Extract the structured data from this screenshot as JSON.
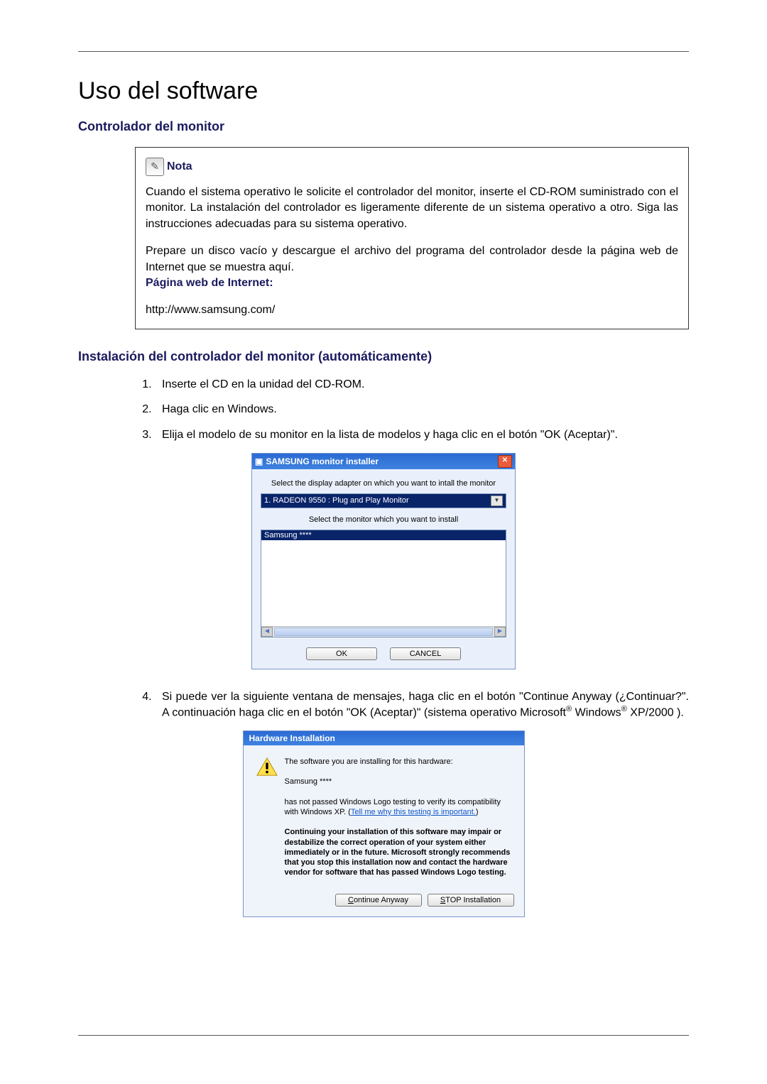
{
  "title": "Uso del software",
  "section_a": "Controlador del monitor",
  "note": {
    "label": "Nota",
    "p1": "Cuando el sistema operativo le solicite el controlador del monitor, inserte el CD-ROM suministrado con el monitor. La instalación del controlador es ligeramente diferente de un sistema operativo a otro. Siga las instrucciones adecuadas para su sistema operativo.",
    "p2": "Prepare un disco vacío y descargue el archivo del programa del controlador desde la página web de Internet que se muestra aquí.",
    "p2b": "Página web de Internet:",
    "url": "http://www.samsung.com/"
  },
  "section_b": "Instalación del controlador del monitor (automáticamente)",
  "steps": {
    "s1": "Inserte el CD en la unidad del CD-ROM.",
    "s2": "Haga clic en Windows.",
    "s3": "Elija el modelo de su monitor en la lista de modelos y haga clic en el botón \"OK (Aceptar)\".",
    "s4a": "Si puede ver la siguiente ventana de mensajes, haga clic en el botón \"Continue Anyway (¿Continuar?\". A continuación haga clic en el botón \"OK (Aceptar)\" (sistema operativo Microsoft",
    "s4b": " Windows",
    "s4c": " XP/2000 )."
  },
  "installer": {
    "title": "SAMSUNG monitor installer",
    "line1": "Select the display adapter on which you want to intall the monitor",
    "adapter": "1. RADEON 9550 : Plug and Play Monitor",
    "line2": "Select the monitor which you want to install",
    "listItem": "Samsung ****",
    "ok": "OK",
    "cancel": "CANCEL"
  },
  "hw": {
    "title": "Hardware Installation",
    "l1": "The software you are installing for this hardware:",
    "l2": "Samsung ****",
    "l3a": "has not passed Windows Logo testing to verify its compatibility with Windows XP. (",
    "link": "Tell me why this testing is important.",
    "l3b": ")",
    "warn": "Continuing your installation of this software may impair or destabilize the correct operation of your system either immediately or in the future. Microsoft strongly recommends that you stop this installation now and contact the hardware vendor for software that has passed Windows Logo testing.",
    "btn_cont": "Continue Anyway",
    "btn_stop": "STOP Installation"
  }
}
